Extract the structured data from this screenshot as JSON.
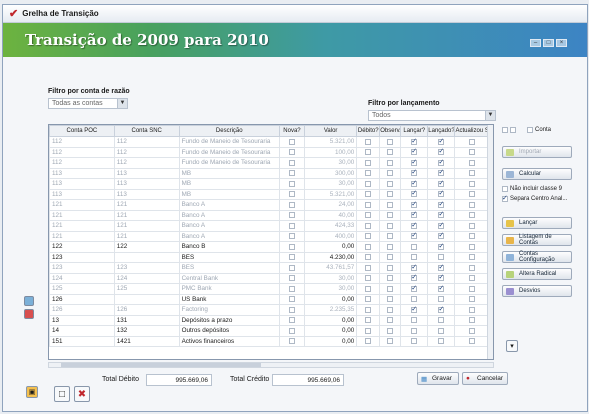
{
  "window": {
    "title": "Grelha de Transição",
    "banner": "Transição de 2009 para 2010"
  },
  "filters": {
    "conta_label": "Filtro por conta de razão",
    "conta_value": "Todas as contas",
    "lanc_label": "Filtro por lançamento",
    "lanc_value": "Todos"
  },
  "columns": [
    "Conta POC",
    "Conta SNC",
    "Descrição",
    "Nova?",
    "Valor",
    "Débito?",
    "Observ.",
    "Lançar?",
    "Lançado?",
    "Actualizou SNC?"
  ],
  "rows": [
    {
      "poc": "112",
      "snc": "112",
      "desc": "Fundo de Maneio de Tesouraria",
      "valor": "5.321,00",
      "lancar": true,
      "lancado": true,
      "dim": true
    },
    {
      "poc": "112",
      "snc": "112",
      "desc": "Fundo de Maneio de Tesouraria",
      "valor": "100,00",
      "lancar": true,
      "lancado": true,
      "dim": true
    },
    {
      "poc": "112",
      "snc": "112",
      "desc": "Fundo de Maneio de Tesouraria",
      "valor": "30,00",
      "lancar": true,
      "lancado": true,
      "dim": true
    },
    {
      "poc": "113",
      "snc": "113",
      "desc": "MB",
      "valor": "300,00",
      "lancar": true,
      "lancado": true,
      "dim": true
    },
    {
      "poc": "113",
      "snc": "113",
      "desc": "MB",
      "valor": "30,00",
      "lancar": true,
      "lancado": true,
      "dim": true
    },
    {
      "poc": "113",
      "snc": "113",
      "desc": "MB",
      "valor": "5.321,00",
      "lancar": true,
      "lancado": true,
      "dim": true
    },
    {
      "poc": "121",
      "snc": "121",
      "desc": "Banco A",
      "valor": "24,00",
      "lancar": true,
      "lancado": true,
      "dim": true
    },
    {
      "poc": "121",
      "snc": "121",
      "desc": "Banco A",
      "valor": "40,00",
      "lancar": true,
      "lancado": true,
      "dim": true
    },
    {
      "poc": "121",
      "snc": "121",
      "desc": "Banco A",
      "valor": "424,33",
      "lancar": true,
      "lancado": true,
      "dim": true
    },
    {
      "poc": "121",
      "snc": "121",
      "desc": "Banco A",
      "valor": "400,00",
      "lancar": true,
      "lancado": true,
      "dim": true
    },
    {
      "poc": "122",
      "snc": "122",
      "desc": "Banco B",
      "valor": "0,00",
      "lancar": false,
      "lancado": true,
      "dim": false
    },
    {
      "poc": "123",
      "snc": "",
      "desc": "BES",
      "valor": "4.230,00",
      "lancar": false,
      "lancado": false,
      "dim": false
    },
    {
      "poc": "123",
      "snc": "123",
      "desc": "BES",
      "valor": "43.761,57",
      "lancar": true,
      "lancado": true,
      "dim": true
    },
    {
      "poc": "124",
      "snc": "124",
      "desc": "Central Bank",
      "valor": "30,00",
      "lancar": true,
      "lancado": true,
      "dim": true
    },
    {
      "poc": "125",
      "snc": "125",
      "desc": "PMC Bank",
      "valor": "30,00",
      "lancar": true,
      "lancado": true,
      "dim": true
    },
    {
      "poc": "126",
      "snc": "",
      "desc": "US Bank",
      "valor": "0,00",
      "lancar": false,
      "lancado": false,
      "dim": false
    },
    {
      "poc": "126",
      "snc": "126",
      "desc": "Factoring",
      "valor": "2.235,35",
      "lancar": true,
      "lancado": true,
      "dim": true
    },
    {
      "poc": "13",
      "snc": "131",
      "desc": "Depósitos a prazo",
      "valor": "0,00",
      "lancar": false,
      "lancado": false,
      "dim": false
    },
    {
      "poc": "14",
      "snc": "132",
      "desc": "Outros depósitos",
      "valor": "0,00",
      "lancar": false,
      "lancado": false,
      "dim": false
    },
    {
      "poc": "151",
      "snc": "1421",
      "desc": "Activos financeiros",
      "valor": "0,00",
      "lancar": false,
      "lancado": false,
      "dim": false
    }
  ],
  "side": {
    "importar": "Importar",
    "calcular": "Calcular",
    "nao_incluir": "Não incluir classe 9",
    "separa": "Separa Centro Anal...",
    "lancar": "Lançar",
    "listagem": "Listagem de Contas",
    "config": "Contas Configuração",
    "alterar": "Altera Radical",
    "desvios": "Desvios",
    "conta_chk": "Conta"
  },
  "footer": {
    "debito_label": "Total Débito",
    "debito_value": "995.669,06",
    "credito_label": "Total Crédito",
    "credito_value": "995.669,06",
    "gravar": "Gravar",
    "cancelar": "Cancelar"
  },
  "colors": {
    "accent": "#3d84c4",
    "green": "#6db33f",
    "red": "#c0272d"
  }
}
